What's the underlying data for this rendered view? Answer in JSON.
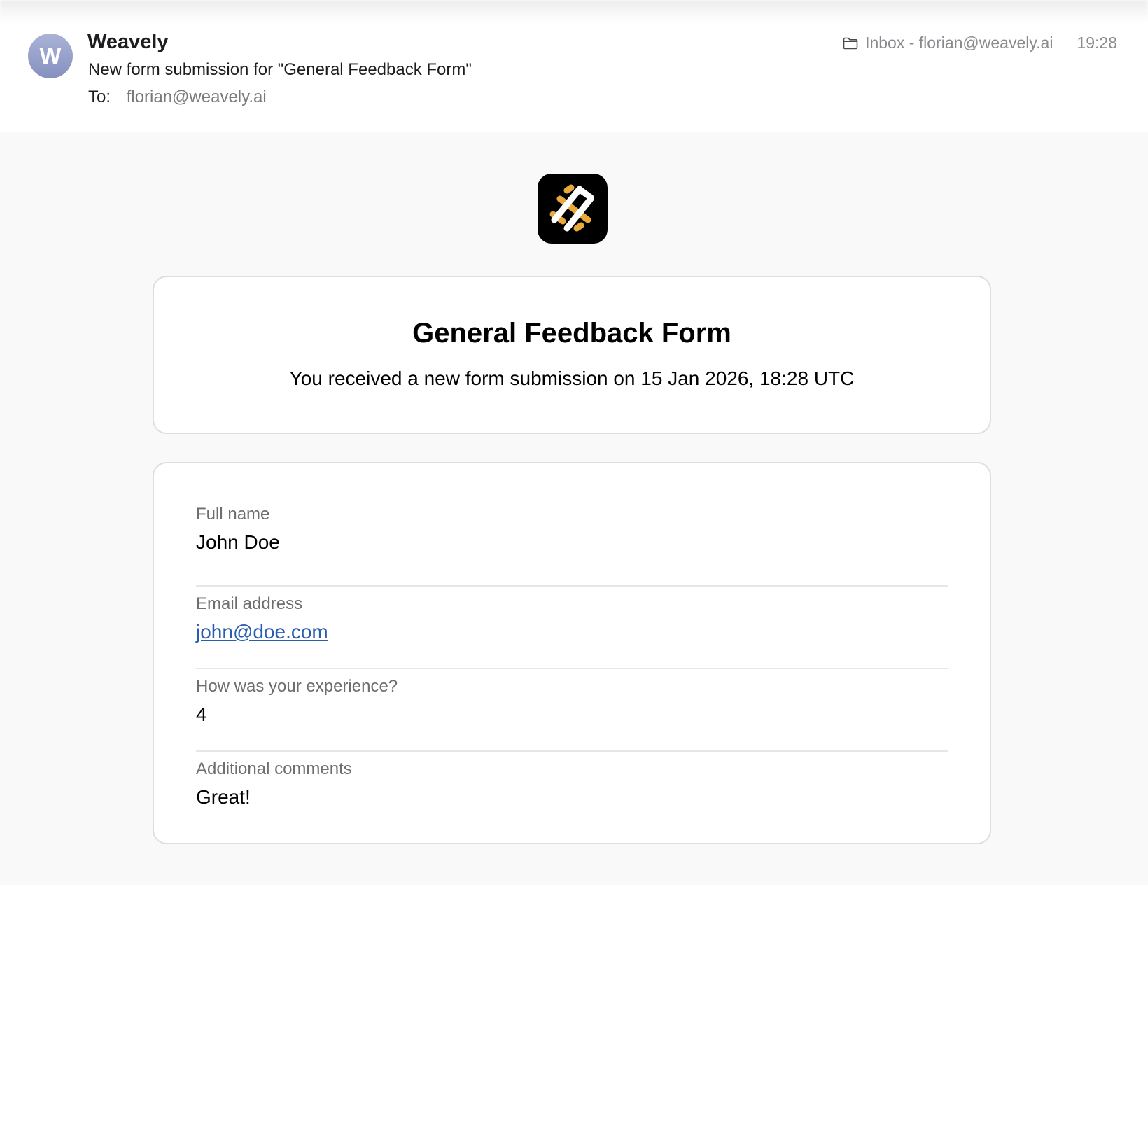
{
  "email": {
    "avatar_letter": "W",
    "sender": "Weavely",
    "subject": "New form submission for \"General Feedback Form\"",
    "to_label": "To:",
    "to_address": "florian@weavely.ai",
    "mailbox": "Inbox - florian@weavely.ai",
    "time": "19:28"
  },
  "form": {
    "title": "General Feedback Form",
    "subtitle": "You received a new form submission on 15 Jan 2026, 18:28 UTC",
    "fields": [
      {
        "label": "Full name",
        "value": "John Doe"
      },
      {
        "label": "Email address",
        "value": "john@doe.com"
      },
      {
        "label": "How was your experience?",
        "value": "4"
      },
      {
        "label": "Additional comments",
        "value": "Great!"
      }
    ]
  },
  "colors": {
    "link": "#2a5db0",
    "logo_accent": "#e8a93a",
    "avatar": "#8f99c6"
  },
  "icons": {
    "folder": "folder-icon",
    "logo": "weavely-logo"
  }
}
